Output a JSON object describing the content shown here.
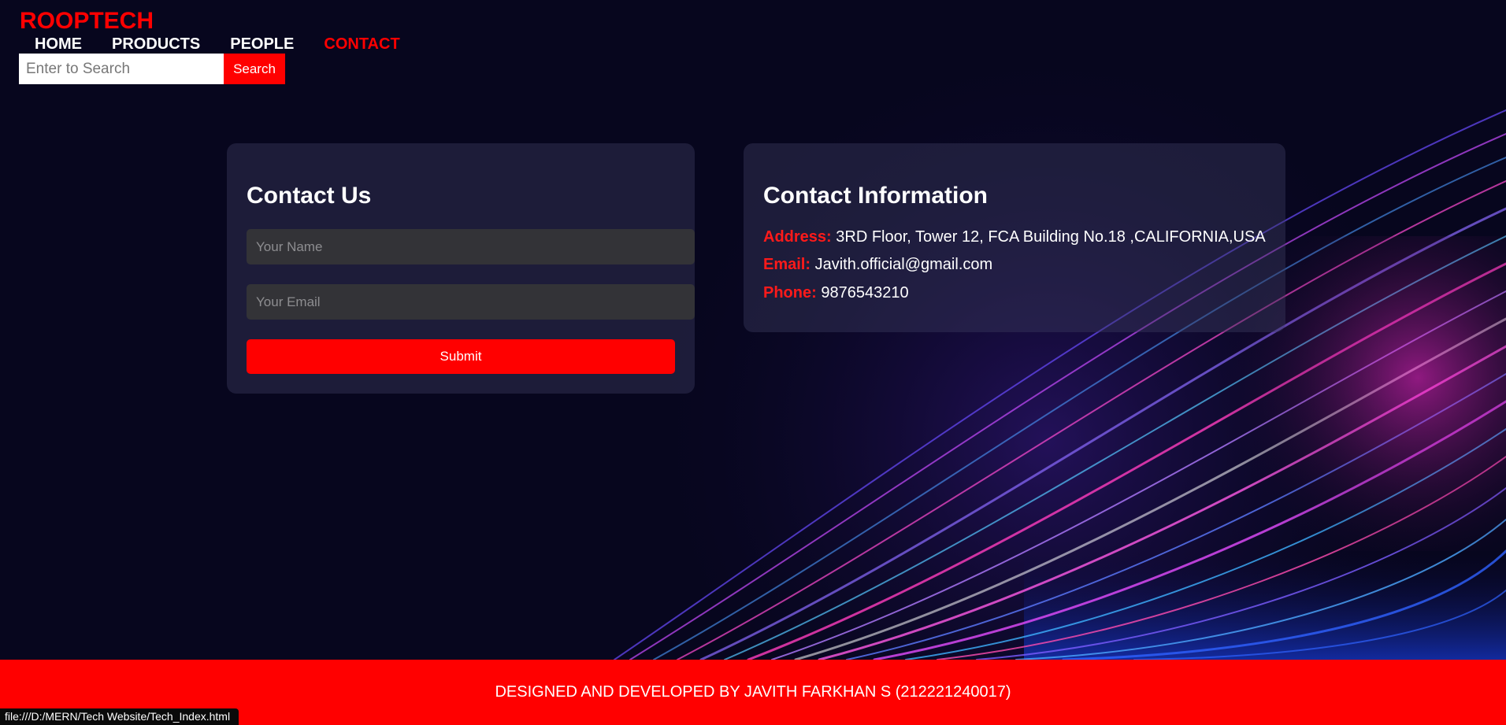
{
  "brand": "ROOPTECH",
  "nav": {
    "home": "HOME",
    "products": "PRODUCTS",
    "people": "PEOPLE",
    "contact": "CONTACT"
  },
  "search": {
    "placeholder": "Enter to Search",
    "button": "Search"
  },
  "contact_form": {
    "title": "Contact Us",
    "name_placeholder": "Your Name",
    "email_placeholder": "Your Email",
    "submit": "Submit"
  },
  "contact_info": {
    "title": "Contact Information",
    "address_label": "Address:",
    "address": "3RD Floor, Tower 12, FCA Building No.18 ,CALIFORNIA,USA",
    "email_label": "Email:",
    "email": "Javith.official@gmail.com",
    "phone_label": "Phone:",
    "phone": "9876543210"
  },
  "footer": "DESIGNED AND DEVELOPED BY JAVITH FARKHAN S (212221240017)",
  "status_url": "file:///D:/MERN/Tech Website/Tech_Index.html",
  "colors": {
    "accent": "#ff0000",
    "background": "#07061e"
  }
}
